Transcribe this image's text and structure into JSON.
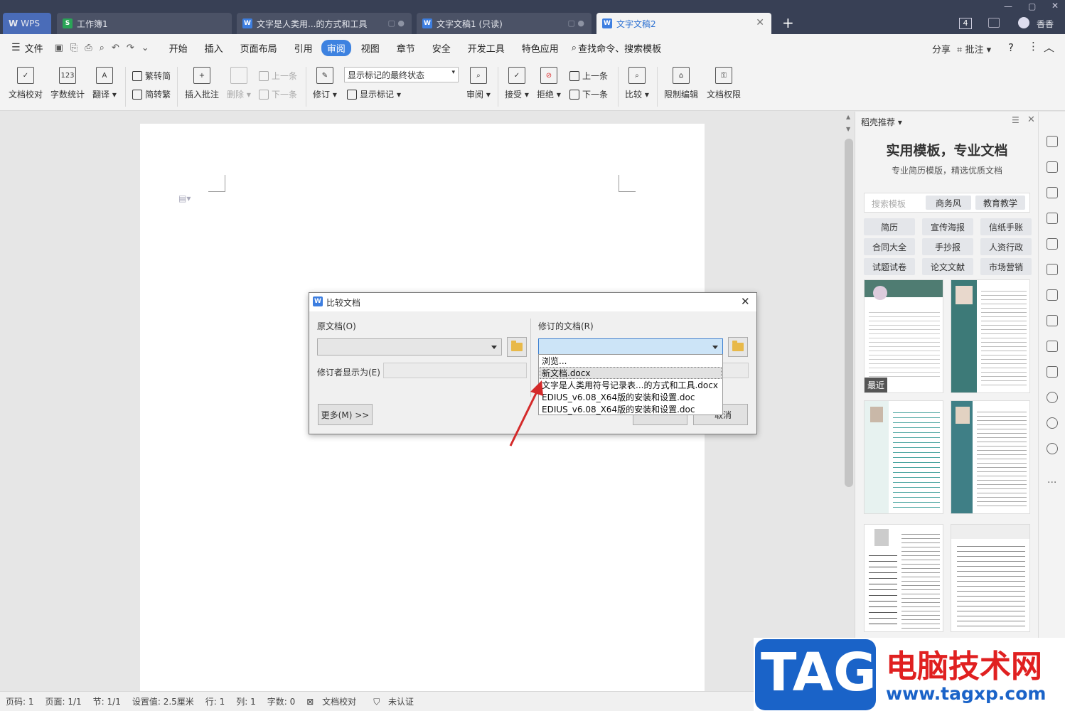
{
  "tabs": {
    "wps_label": "WPS",
    "items": [
      {
        "label": "工作簿1"
      },
      {
        "label": "文字是人类用...的方式和工具"
      },
      {
        "label": "文字文稿1 (只读)"
      },
      {
        "label": "文字文稿2"
      }
    ],
    "new_tab": "+",
    "tab_count": "4",
    "user_name": "香香"
  },
  "menu": {
    "file": "文件",
    "items": [
      "开始",
      "插入",
      "页面布局",
      "引用",
      "审阅",
      "视图",
      "章节",
      "安全",
      "开发工具",
      "特色应用"
    ],
    "active": "审阅",
    "search": "查找命令、搜索模板",
    "share": "分享",
    "comment": "批注",
    "help": "?"
  },
  "ribbon": {
    "proofread": "文档校对",
    "word_count": "字数统计",
    "translate": "翻译",
    "to_traditional": "繁转简",
    "to_simplified": "简转繁",
    "insert_comment": "插入批注",
    "delete": "删除",
    "prev": "上一条",
    "next": "下一条",
    "track": "修订",
    "markup_state": "显示标记的最终状态",
    "show_markup": "显示标记",
    "review": "审阅",
    "accept": "接受",
    "reject": "拒绝",
    "prev_change": "上一条",
    "next_change": "下一条",
    "compare": "比较",
    "restrict": "限制编辑",
    "permission": "文档权限"
  },
  "panel": {
    "header": "稻壳推荐",
    "title": "实用模板，专业文档",
    "subtitle": "专业简历模版，精选优质文档",
    "search_placeholder": "搜索模板",
    "quick_tags": [
      "商务风",
      "教育教学"
    ],
    "tags": [
      "简历",
      "宣传海报",
      "信纸手账",
      "合同大全",
      "手抄报",
      "人资行政",
      "试题试卷",
      "论文文献",
      "市场营销"
    ],
    "recent_badge": "最近"
  },
  "status": {
    "page_num": "页码: 1",
    "page": "页面: 1/1",
    "section": "节: 1/1",
    "setting": "设置值: 2.5厘米",
    "row": "行: 1",
    "col": "列: 1",
    "words": "字数: 0",
    "proof": "文档校对",
    "cert": "未认证"
  },
  "dialog": {
    "title": "比较文档",
    "original_label": "原文档(O)",
    "revised_label": "修订的文档(R)",
    "reviewer_label": "修订者显示为(E)",
    "more_button": "更多(M) >>",
    "cancel_partial": "取消",
    "dropdown_options": [
      "浏览...",
      "新文档.docx",
      "文字是人类用符号记录表...的方式和工具.docx",
      "EDIUS_v6.08_X64版的安装和设置.doc",
      "EDIUS_v6.08_X64版的安装和设置.doc"
    ],
    "highlighted_option": "新文档.docx"
  },
  "watermark": {
    "tag": "TAG",
    "site_name": "电脑技术网",
    "url": "www.tagxp.com"
  },
  "colors": {
    "titlebar": "#384055",
    "accent": "#3d82e0",
    "dialog_bg": "#f0f0f0",
    "arrow": "#d42a2a",
    "tag_blue": "#1a63c8",
    "tag_red": "#e02020"
  }
}
